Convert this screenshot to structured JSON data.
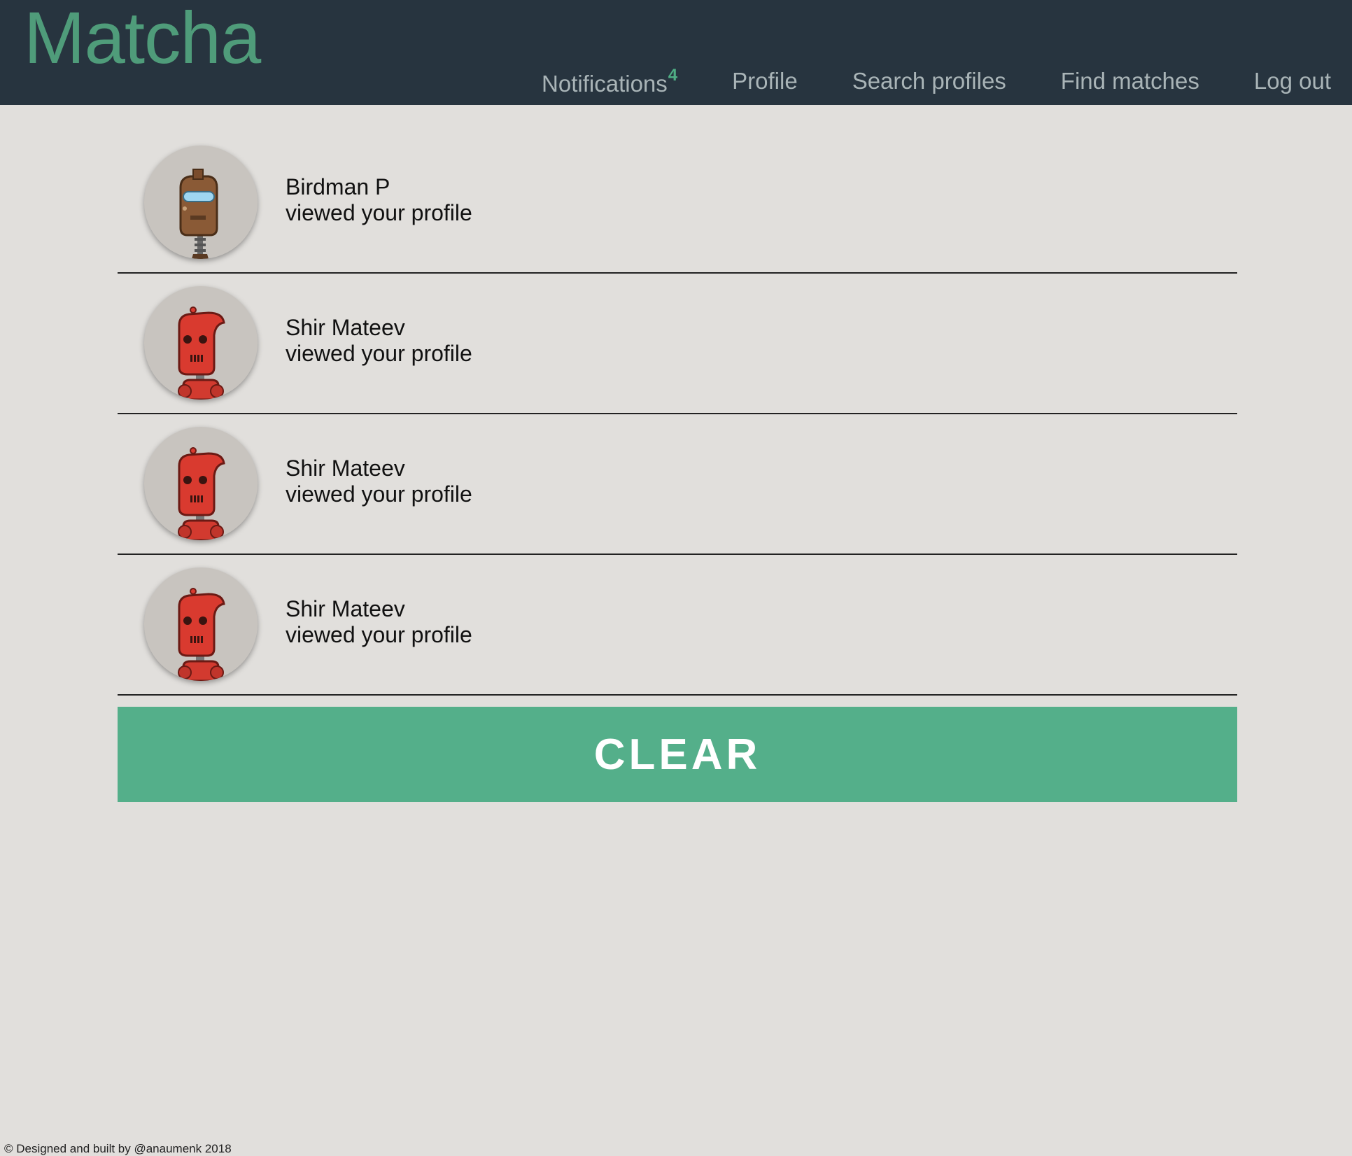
{
  "header": {
    "logo": "Matcha",
    "nav": {
      "notifications": "Notifications",
      "notifications_count": "4",
      "profile": "Profile",
      "search": "Search profiles",
      "find": "Find matches",
      "logout": "Log out"
    }
  },
  "notifications": [
    {
      "name": "Birdman P",
      "action": "viewed your profile",
      "avatar": "brown-robot-icon"
    },
    {
      "name": "Shir Mateev",
      "action": "viewed your profile",
      "avatar": "red-robot-icon"
    },
    {
      "name": "Shir Mateev",
      "action": "viewed your profile",
      "avatar": "red-robot-icon"
    },
    {
      "name": "Shir Mateev",
      "action": "viewed your profile",
      "avatar": "red-robot-icon"
    }
  ],
  "clear_label": "CLEAR",
  "footer": "© Designed and built by @anaumenk 2018",
  "colors": {
    "header_bg": "#27343f",
    "logo": "#4f9c7a",
    "accent": "#54af8a",
    "page_bg": "#e1dfdc"
  }
}
